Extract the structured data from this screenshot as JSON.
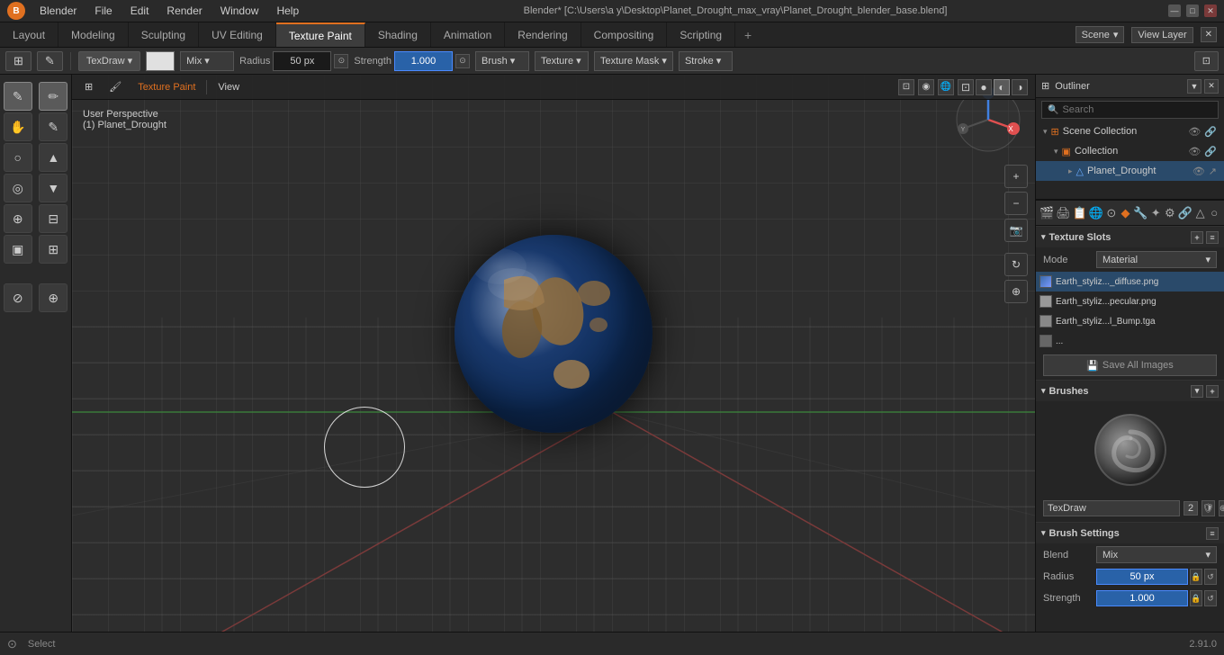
{
  "app": {
    "title": "Blender* [C:\\Users\\a y\\Desktop\\Planet_Drought_max_vray\\Planet_Drought_blender_base.blend]",
    "version": "2.91.0"
  },
  "menu": {
    "items": [
      "Blender",
      "File",
      "Edit",
      "Render",
      "Window",
      "Help"
    ]
  },
  "tabs": {
    "items": [
      "Layout",
      "Modeling",
      "Sculpting",
      "UV Editing",
      "Texture Paint",
      "Shading",
      "Animation",
      "Rendering",
      "Compositing",
      "Scripting"
    ],
    "active": "Texture Paint",
    "plus_label": "+",
    "scene_label": "Scene",
    "view_layer_label": "View Layer"
  },
  "toolbar": {
    "mode_label": "TexDraw",
    "blend_label": "Mix",
    "radius_label": "Radius",
    "radius_value": "50 px",
    "strength_label": "Strength",
    "strength_value": "1.000",
    "brush_label": "Brush",
    "texture_label": "Texture",
    "texture_mask_label": "Texture Mask",
    "stroke_label": "Stroke"
  },
  "viewport": {
    "header": "User Perspective",
    "subheader": "(1) Planet_Drought",
    "paint_mode": "Texture Paint",
    "view_label": "View",
    "panels": [
      "Texture Paint",
      "View"
    ]
  },
  "outliner": {
    "title": "Scene Collection",
    "items": [
      {
        "label": "Scene Collection",
        "icon": "scene",
        "level": 0
      },
      {
        "label": "Collection",
        "icon": "collection",
        "level": 1
      },
      {
        "label": "Planet_Drought",
        "icon": "object",
        "level": 2,
        "selected": true
      }
    ]
  },
  "properties": {
    "search_placeholder": "Search",
    "texture_slots_title": "Texture Slots",
    "mode_label": "Mode",
    "mode_value": "Material",
    "textures": [
      {
        "name": "Earth_styliz..._diffuse.png",
        "active": true
      },
      {
        "name": "Earth_styliz...pecular.png",
        "active": false
      },
      {
        "name": "Earth_styliz...l_Bump.tga",
        "active": false
      },
      {
        "name": "...",
        "active": false
      }
    ],
    "save_all_images": "Save All Images",
    "brushes_title": "Brushes",
    "brush_name": "TexDraw",
    "brush_count": "2",
    "brush_settings_title": "Brush Settings",
    "blend_label": "Blend",
    "blend_value": "Mix",
    "radius_label": "Radius",
    "radius_value": "50 px",
    "strength_label": "Strength",
    "strength_value": "1.000"
  },
  "status_bar": {
    "select_label": "Select",
    "version": "2.91.0",
    "info": ""
  },
  "tools": {
    "left_col": [
      "✎",
      "✋",
      "●",
      "▲",
      "▼",
      "⬜",
      "⟷"
    ],
    "right_col": [
      "✎",
      "✎",
      "▲",
      "▲",
      "⬜",
      "⬜",
      "✎"
    ]
  },
  "icons": {
    "arrow_down": "▾",
    "arrow_right": "▸",
    "eye": "👁",
    "link": "🔗",
    "camera": "📷",
    "light": "💡",
    "mesh": "△",
    "save": "💾",
    "search": "🔍",
    "expand": "▾",
    "collapse": "◂",
    "add": "+",
    "remove": "✕"
  },
  "colors": {
    "accent": "#e07020",
    "active_tab_bg": "#3d3d3d",
    "selected_row": "#2a4a6a",
    "active_texture": "#2962a8"
  }
}
